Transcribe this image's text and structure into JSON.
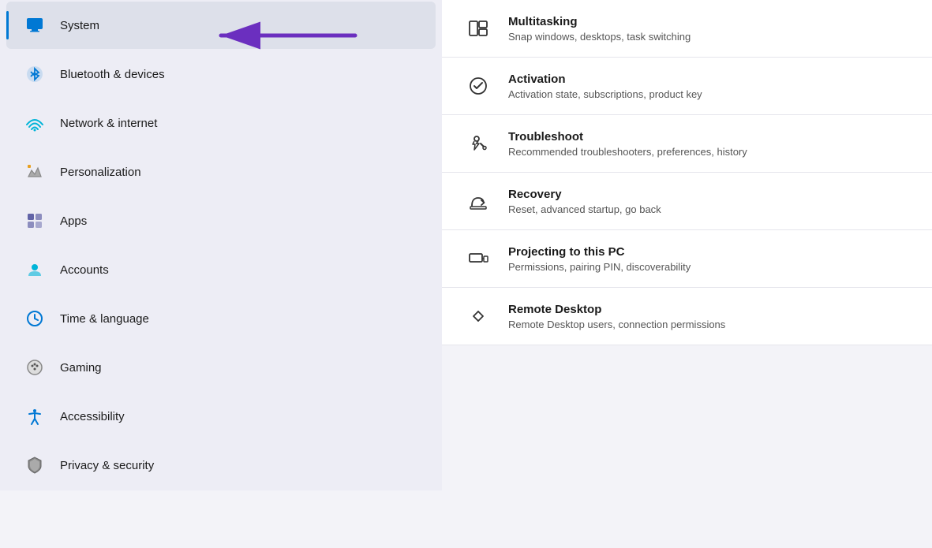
{
  "sidebar": {
    "items": [
      {
        "id": "system",
        "label": "System",
        "icon": "system",
        "active": true
      },
      {
        "id": "bluetooth",
        "label": "Bluetooth & devices",
        "icon": "bluetooth",
        "active": false
      },
      {
        "id": "network",
        "label": "Network & internet",
        "icon": "network",
        "active": false
      },
      {
        "id": "personalization",
        "label": "Personalization",
        "icon": "personalization",
        "active": false
      },
      {
        "id": "apps",
        "label": "Apps",
        "icon": "apps",
        "active": false
      },
      {
        "id": "accounts",
        "label": "Accounts",
        "icon": "accounts",
        "active": false
      },
      {
        "id": "time",
        "label": "Time & language",
        "icon": "time",
        "active": false
      },
      {
        "id": "gaming",
        "label": "Gaming",
        "icon": "gaming",
        "active": false
      },
      {
        "id": "accessibility",
        "label": "Accessibility",
        "icon": "accessibility",
        "active": false
      },
      {
        "id": "privacy",
        "label": "Privacy & security",
        "icon": "privacy",
        "active": false
      }
    ]
  },
  "main": {
    "items": [
      {
        "id": "snap",
        "title": "Multitasking",
        "desc": "Snap windows, desktops, task switching",
        "icon": "snap"
      },
      {
        "id": "activation",
        "title": "Activation",
        "desc": "Activation state, subscriptions, product key",
        "icon": "activation"
      },
      {
        "id": "troubleshoot",
        "title": "Troubleshoot",
        "desc": "Recommended troubleshooters, preferences, history",
        "icon": "troubleshoot"
      },
      {
        "id": "recovery",
        "title": "Recovery",
        "desc": "Reset, advanced startup, go back",
        "icon": "recovery"
      },
      {
        "id": "projecting",
        "title": "Projecting to this PC",
        "desc": "Permissions, pairing PIN, discoverability",
        "icon": "projecting"
      },
      {
        "id": "remotedesktop",
        "title": "Remote Desktop",
        "desc": "Remote Desktop users, connection permissions",
        "icon": "remotedesktop"
      }
    ]
  }
}
